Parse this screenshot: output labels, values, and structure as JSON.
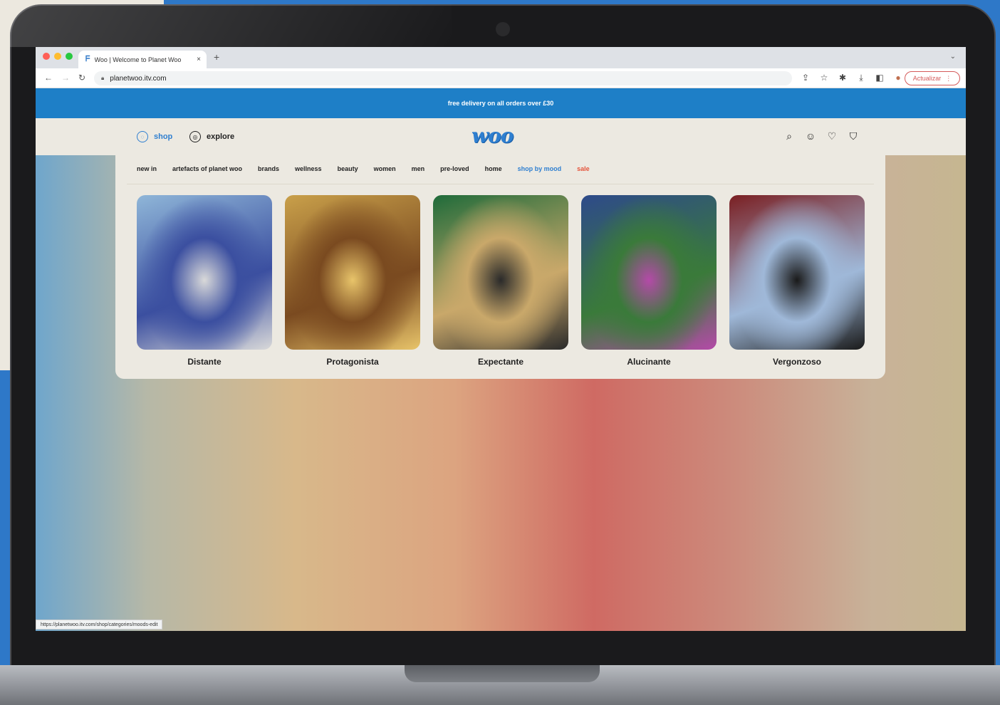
{
  "browser": {
    "tab_title": "Woo | Welcome to Planet Woo",
    "tab_close": "×",
    "new_tab": "+",
    "url": "planetwoo.itv.com",
    "update_button": "Actualizar",
    "status_url": "https://planetwoo.itv.com/shop/categories/moods-edit",
    "icons": [
      "share-icon",
      "star-icon",
      "extensions-icon",
      "download-icon",
      "sidepanel-icon",
      "profile-icon"
    ]
  },
  "site": {
    "promo_text": "free delivery on all orders over £30",
    "nav_shop": "shop",
    "nav_explore": "explore",
    "logo": "woo",
    "header_icons": [
      "search-icon",
      "account-icon",
      "wishlist-icon",
      "basket-icon"
    ],
    "categories": [
      {
        "label": "new in",
        "color": "#222222"
      },
      {
        "label": "artefacts of planet woo",
        "color": "#222222"
      },
      {
        "label": "brands",
        "color": "#222222"
      },
      {
        "label": "wellness",
        "color": "#222222"
      },
      {
        "label": "beauty",
        "color": "#222222"
      },
      {
        "label": "women",
        "color": "#222222"
      },
      {
        "label": "men",
        "color": "#222222"
      },
      {
        "label": "pre-loved",
        "color": "#222222"
      },
      {
        "label": "home",
        "color": "#222222"
      },
      {
        "label": "shop by mood",
        "color": "#2f7fd0"
      },
      {
        "label": "sale",
        "color": "#e5533a"
      }
    ],
    "moods": [
      {
        "label": "Distante",
        "colors": [
          "#8fb6d8",
          "#3b4fa0",
          "#d9d9d9"
        ]
      },
      {
        "label": "Protagonista",
        "colors": [
          "#c9a04a",
          "#7a4a20",
          "#e8c46a"
        ]
      },
      {
        "label": "Expectante",
        "colors": [
          "#1f6b3a",
          "#c9a86a",
          "#2a2a2a"
        ]
      },
      {
        "label": "Alucinante",
        "colors": [
          "#2e4a8a",
          "#3a7a3a",
          "#b44aa8"
        ]
      },
      {
        "label": "Vergonzoso",
        "colors": [
          "#7a1f22",
          "#9fb8d8",
          "#1a1a1a"
        ]
      }
    ]
  },
  "colors": {
    "brand_blue": "#1e7fc7",
    "accent_blue": "#2f7fd0",
    "sale_red": "#e5533a"
  }
}
